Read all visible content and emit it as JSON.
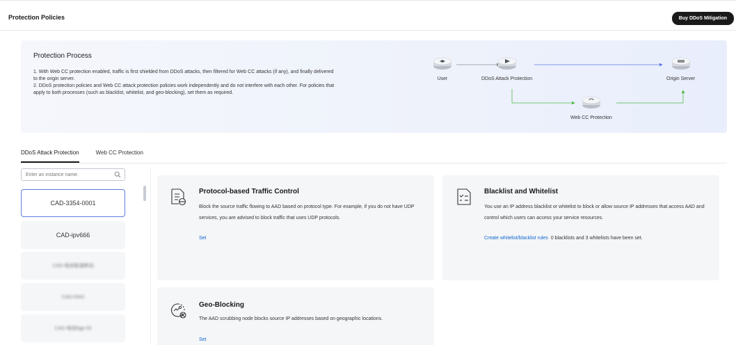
{
  "header": {
    "title": "Protection Policies",
    "buy_button": "Buy DDoS Mitigation"
  },
  "process": {
    "title": "Protection Process",
    "lines": [
      "1. With Web CC protection enabled, traffic is first shielded from DDoS attacks, then filtered for Web CC attacks (if any), and finally delivered",
      "to the origin server.",
      "2. DDoS protection policies and Web CC attack protection policies work independently and do not interfere with each other. For policies that",
      "apply to both processes (such as blacklist, whitelist, and geo-blocking), set them as required."
    ],
    "nodes": {
      "user": "User",
      "ddos": "DDoS Attack Protection",
      "origin": "Origin Server",
      "webcc": "Web CC Protection"
    },
    "colors": {
      "blue_arrow": "#5e7ce0",
      "green_arrow": "#50b848"
    }
  },
  "tabs": [
    {
      "label": "DDoS Attack Protection",
      "active": true
    },
    {
      "label": "Web CC Protection",
      "active": false
    }
  ],
  "search": {
    "placeholder": "Enter an instance name."
  },
  "instances": [
    {
      "label": "CAD-3354-0001",
      "selected": true,
      "blurred": false
    },
    {
      "label": "CAD-ipv666",
      "selected": false,
      "blurred": false
    },
    {
      "label": "CAD-电信联通移动",
      "selected": false,
      "blurred": true
    },
    {
      "label": "CAD-0342",
      "selected": false,
      "blurred": true
    },
    {
      "label": "CAD-电信bgp-03",
      "selected": false,
      "blurred": true
    }
  ],
  "cards": {
    "protocol": {
      "title": "Protocol-based Traffic Control",
      "desc": "Block the source traffic flowing to AAD based on protocol type. For example, if you do not have UDP services, you are advised to block traffic that uses UDP protocols.",
      "link": "Set",
      "icon": "document-block-icon"
    },
    "blacklist": {
      "title": "Blacklist and Whitelist",
      "desc": "You use an IP address blacklist or whitelist to block or allow source IP addresses that access AAD and control which users can access your service resources.",
      "link": "Create whitelist/blacklist rules",
      "note": "0 blacklists and 3 whitelists have been set.",
      "icon": "list-check-icon"
    },
    "geo": {
      "title": "Geo-Blocking",
      "desc": "The AAD scrubbing node blocks source IP addresses based on geographic locations.",
      "link": "Set",
      "icon": "geo-block-icon"
    }
  }
}
